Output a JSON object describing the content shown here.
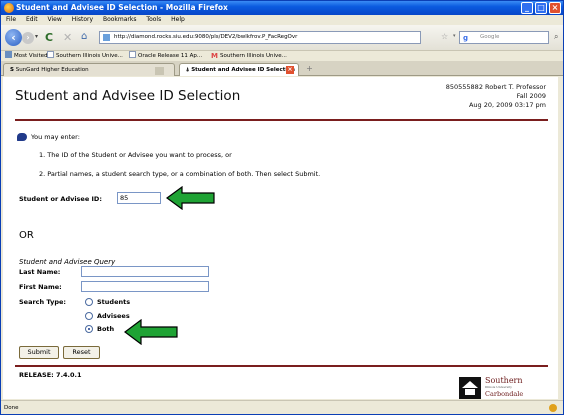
{
  "window": {
    "title": "Student and Advisee ID Selection - Mozilla Firefox"
  },
  "menu": [
    "File",
    "Edit",
    "View",
    "History",
    "Bookmarks",
    "Tools",
    "Help"
  ],
  "nav": {
    "url": "http://diamond.rocks.siu.edu:9080/pls/DEV2/bwlkfrov.P_FacRegOvr",
    "search_placeholder": "Google"
  },
  "bookmarks": [
    "Most Visited",
    "Southern Illinois Unive...",
    "Oracle Release 11 Ap...",
    "Southern Illinois Unive..."
  ],
  "tabs": [
    {
      "label": "SunGard Higher Education",
      "active": false
    },
    {
      "label": "Student and Advisee ID Selection",
      "active": true
    }
  ],
  "page": {
    "title": "Student and Advisee ID Selection",
    "user_line": "850555882 Robert T. Professor",
    "term": "Fall 2009",
    "datetime": "Aug 20, 2009 03:17 pm",
    "info": "You may enter:",
    "items": [
      "1. The ID of the Student or Advisee you want to process, or",
      "2. Partial names, a student search type, or a combination of both. Then select Submit."
    ],
    "id_label": "Student or Advisee ID:",
    "id_value": "85",
    "or_label": "OR",
    "query_title": "Student and Advisee Query",
    "last_name_label": "Last Name:",
    "first_name_label": "First Name:",
    "search_type_label": "Search Type:",
    "search_types": [
      {
        "label": "Students",
        "selected": false
      },
      {
        "label": "Advisees",
        "selected": false
      },
      {
        "label": "Both",
        "selected": true
      }
    ],
    "submit_label": "Submit",
    "reset_label": "Reset",
    "release": "RELEASE: 7.4.0.1",
    "logo": {
      "line1": "Southern",
      "line2": "Illinois University",
      "line3": "Carbondale"
    }
  },
  "status": {
    "text": "Done"
  },
  "colors": {
    "accent_bar": "#7a1e1e",
    "arrow": "#1fa334",
    "titlebar": "#0a5adf"
  }
}
